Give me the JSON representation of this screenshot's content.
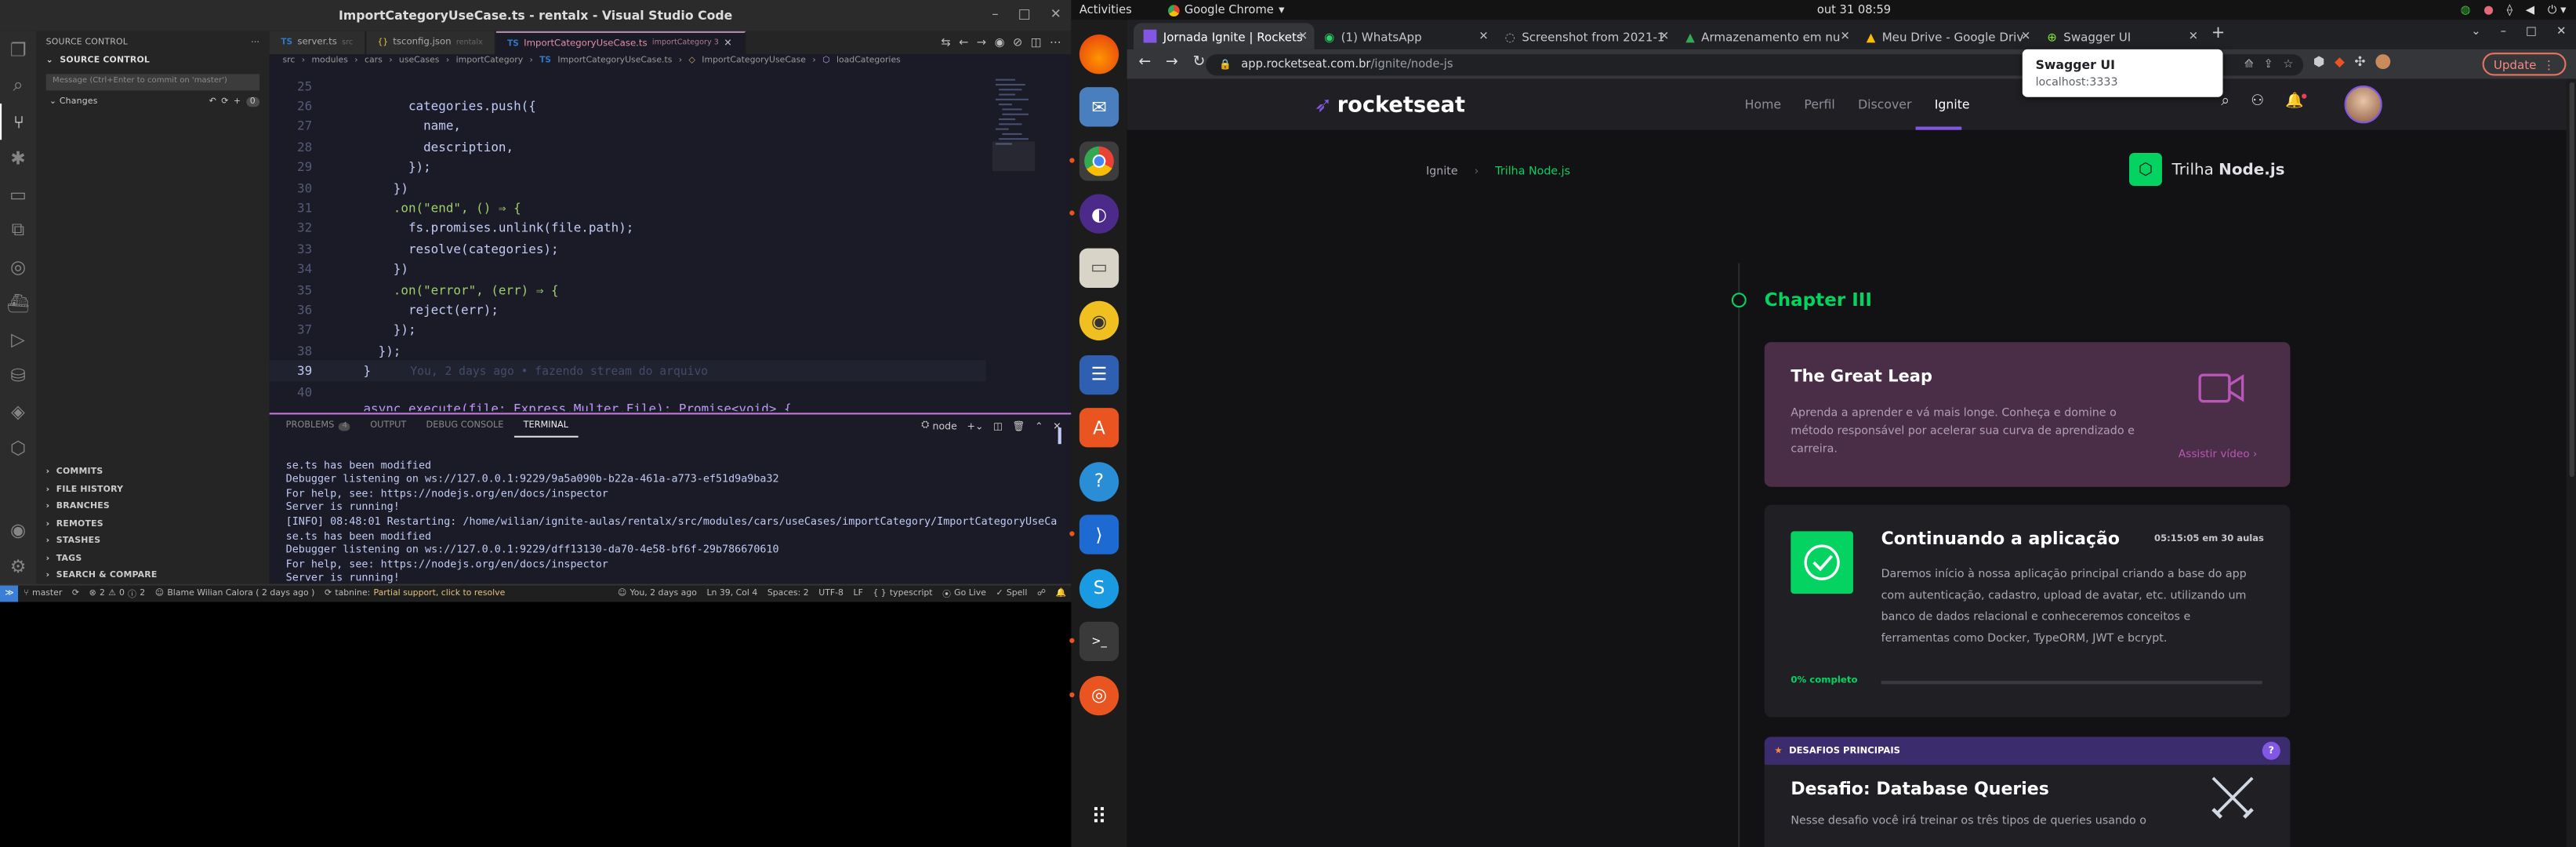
{
  "vscode": {
    "window_title": "ImportCategoryUseCase.ts - rentalx - Visual Studio Code",
    "sidebar": {
      "header": "SOURCE CONTROL",
      "section": "SOURCE CONTROL",
      "message_placeholder": "Message (Ctrl+Enter to commit on 'master')",
      "changes_label": "Changes",
      "changes_count": "0",
      "bottom_sections": [
        "COMMITS",
        "FILE HISTORY",
        "BRANCHES",
        "REMOTES",
        "STASHES",
        "TAGS",
        "SEARCH & COMPARE"
      ]
    },
    "tabs": [
      {
        "name": "server.ts",
        "dir": "src"
      },
      {
        "name": "tsconfig.json",
        "dir": "rentalx"
      },
      {
        "name": "ImportCategoryUseCase.ts",
        "dir": "importCategory 3"
      }
    ],
    "breadcrumb": [
      "src",
      "modules",
      "cars",
      "useCases",
      "importCategory",
      "ImportCategoryUseCase.ts",
      "ImportCategoryUseCase",
      "loadCategories"
    ],
    "code_lines": [
      {
        "n": "25",
        "t": ""
      },
      {
        "n": "26",
        "t": "        categories.push({"
      },
      {
        "n": "27",
        "t": "          name,"
      },
      {
        "n": "28",
        "t": "          description,"
      },
      {
        "n": "29",
        "t": "        });"
      },
      {
        "n": "30",
        "t": "      })"
      },
      {
        "n": "31",
        "t": "      .on(\"end\", () ⇒ {"
      },
      {
        "n": "32",
        "t": "        fs.promises.unlink(file.path);"
      },
      {
        "n": "33",
        "t": "        resolve(categories);"
      },
      {
        "n": "34",
        "t": "      })"
      },
      {
        "n": "35",
        "t": "      .on(\"error\", (err) ⇒ {"
      },
      {
        "n": "36",
        "t": "        reject(err);"
      },
      {
        "n": "37",
        "t": "      });"
      },
      {
        "n": "38",
        "t": "    });"
      },
      {
        "n": "39",
        "t": "  }"
      },
      {
        "n": "40",
        "t": ""
      }
    ],
    "blame_ghost": "You, 2 days ago • fazendo  stream do arquivo",
    "partial_line": "  async execute(file: Express.Multer.File): Promise<void> {",
    "panel_tabs": [
      {
        "label": "PROBLEMS",
        "badge": "4"
      },
      {
        "label": "OUTPUT",
        "badge": ""
      },
      {
        "label": "DEBUG CONSOLE",
        "badge": ""
      },
      {
        "label": "TERMINAL",
        "badge": ""
      }
    ],
    "terminal_select": "node",
    "terminal_lines": [
      "se.ts has been modified",
      "Debugger listening on ws://127.0.0.1:9229/9a5a090b-b22a-461a-a773-ef51d9a9ba32",
      "For help, see: https://nodejs.org/en/docs/inspector",
      "Server is running!",
      "[INFO] 08:48:01 Restarting: /home/wilian/ignite-aulas/rentalx/src/modules/cars/useCases/importCategory/ImportCategoryUseCa",
      "se.ts has been modified",
      "Debugger listening on ws://127.0.0.1:9229/dff13130-da70-4e58-bf6f-29b786670610",
      "For help, see: https://nodejs.org/en/docs/inspector",
      "Server is running!"
    ],
    "status": {
      "branch": "master",
      "problems": "2",
      "warnings": "0",
      "infos": "2",
      "blame": "Blame Wilian Calora ( 2 days ago )",
      "tabnine": "tabnine:",
      "tabnine_msg": "Partial support, click to resolve",
      "right": [
        "You, 2 days ago",
        "Ln 39, Col 4",
        "Spaces: 2",
        "UTF-8",
        "LF",
        "typescript",
        "Go Live",
        "Spell"
      ]
    }
  },
  "topbar": {
    "activities": "Activities",
    "app": "Google Chrome",
    "clock": "out 31  08:59"
  },
  "chrome": {
    "tabs": [
      {
        "title": "Jornada Ignite | Rockets",
        "active": true
      },
      {
        "title": "(1) WhatsApp",
        "active": false
      },
      {
        "title": "Screenshot from 2021-1",
        "active": false
      },
      {
        "title": "Armazenamento em nu",
        "active": false
      },
      {
        "title": "Meu Drive - Google Driv",
        "active": false
      },
      {
        "title": "Swagger UI",
        "active": false
      }
    ],
    "url_host": "app.rocketseat.com.br",
    "url_path": "/ignite/node-js",
    "update_label": "Update",
    "tooltip": {
      "title": "Swagger UI",
      "url": "localhost:3333"
    }
  },
  "rocketseat": {
    "logo": "rocketseat",
    "nav": [
      "Home",
      "Perfil",
      "Discover",
      "Ignite"
    ],
    "breadcrumb": [
      "Ignite",
      "Trilha Node.js"
    ],
    "track_title_prefix": "Trilha ",
    "track_title_bold": "Node.js",
    "chapter": "Chapter III",
    "great_leap": {
      "title": "The Great Leap",
      "desc": "Aprenda a aprender e vá mais longe. Conheça e domine o método responsável por acelerar sua curva de aprendizado e carreira.",
      "link": "Assistir vídeo"
    },
    "continuing": {
      "title": "Continuando a aplicação",
      "meta": "05:15:05 em 30 aulas",
      "desc": "Daremos início à nossa aplicação principal criando a base do app com autenticação, cadastro, upload de avatar, etc. utilizando um banco de dados relacional e conheceremos conceitos e ferramentas como Docker, TypeORM, JWT e bcrypt.",
      "progress_label": "0% completo",
      "progress": 0
    },
    "challenges": {
      "header": "DESAFIOS PRINCIPAIS",
      "title": "Desafio: Database Queries",
      "desc": "Nesse desafio você irá treinar os três tipos de queries usando o"
    }
  },
  "colors": {
    "rocketseat_green": "#04d361",
    "purple_card": "#4a2e48",
    "challenge_header": "#3b2c6e"
  }
}
